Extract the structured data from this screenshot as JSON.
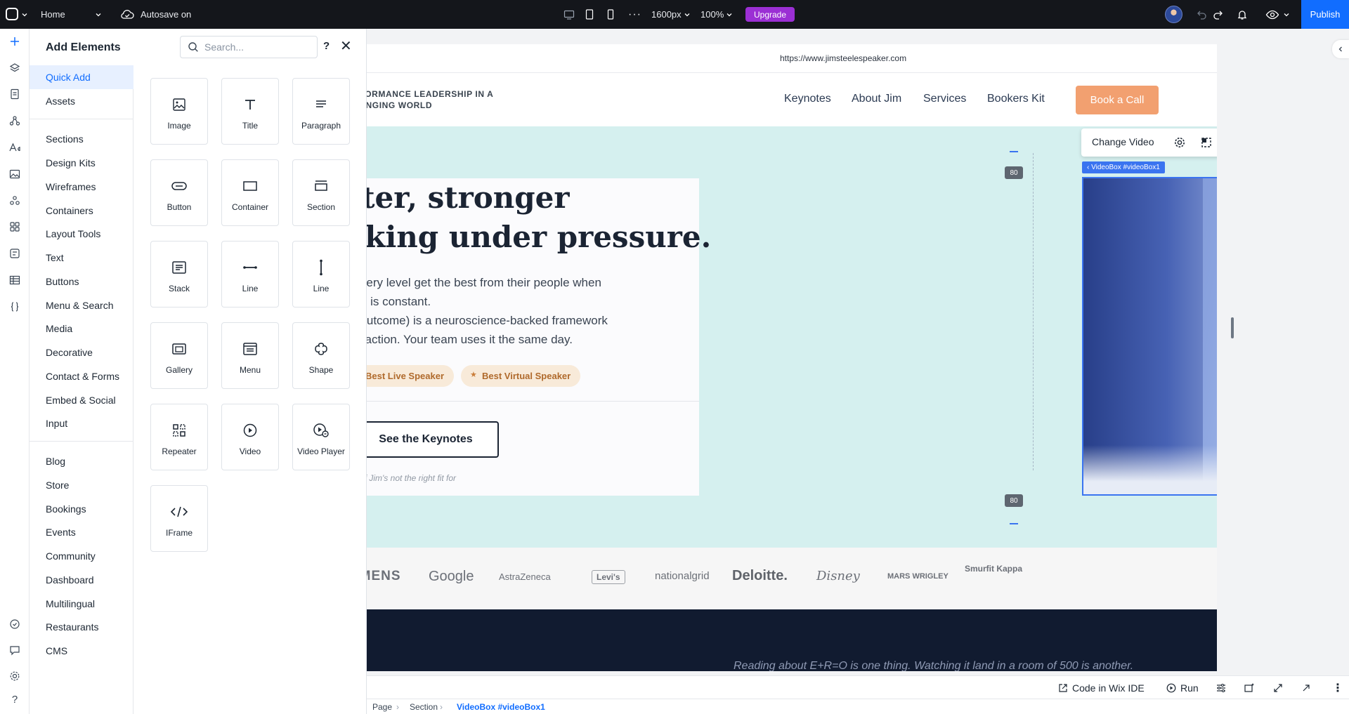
{
  "topbar": {
    "page_name": "Home",
    "autosave": "Autosave on",
    "width_label": "1600px",
    "zoom_label": "100%",
    "upgrade_label": "Upgrade",
    "publish_label": "Publish"
  },
  "panel": {
    "title": "Add Elements",
    "search_placeholder": "Search...",
    "help": "?",
    "categories_group1": [
      "Quick Add",
      "Assets"
    ],
    "categories_group2": [
      "Sections",
      "Design Kits",
      "Wireframes",
      "Containers",
      "Layout Tools",
      "Text",
      "Buttons",
      "Menu & Search",
      "Media",
      "Decorative",
      "Contact & Forms",
      "Embed & Social",
      "Input"
    ],
    "categories_group3": [
      "Blog",
      "Store",
      "Bookings",
      "Events",
      "Community",
      "Dashboard",
      "Multilingual",
      "Restaurants",
      "CMS"
    ],
    "tiles": [
      {
        "label": "Image",
        "icon": "image-icon"
      },
      {
        "label": "Title",
        "icon": "title-icon"
      },
      {
        "label": "Paragraph",
        "icon": "paragraph-icon"
      },
      {
        "label": "Button",
        "icon": "button-icon"
      },
      {
        "label": "Container",
        "icon": "container-icon"
      },
      {
        "label": "Section",
        "icon": "section-icon"
      },
      {
        "label": "Stack",
        "icon": "stack-icon"
      },
      {
        "label": "Line",
        "icon": "horizontal-line-icon"
      },
      {
        "label": "Line",
        "icon": "vertical-line-icon"
      },
      {
        "label": "Gallery",
        "icon": "gallery-icon"
      },
      {
        "label": "Menu",
        "icon": "menu-icon"
      },
      {
        "label": "Shape",
        "icon": "shape-icon"
      },
      {
        "label": "Repeater",
        "icon": "repeater-icon"
      },
      {
        "label": "Video",
        "icon": "video-icon"
      },
      {
        "label": "Video Player",
        "icon": "video-player-icon"
      },
      {
        "label": "IFrame",
        "icon": "iframe-icon"
      }
    ]
  },
  "site": {
    "url": "https://www.jimsteelespeaker.com",
    "tagline_line1": "RFORMANCE LEADERSHIP IN A",
    "tagline_line2": "HANGING WORLD",
    "nav": [
      "Keynotes",
      "About Jim",
      "Services",
      "Bookers Kit"
    ],
    "cta": "Book a Call",
    "headline_line1": "rter, stronger",
    "headline_line2": "aking under pressure.",
    "body_lines": [
      "t every level get the best from their people when",
      "nge is constant.",
      "= Outcome) is a neuroscience-backed framework",
      "r reaction. Your team uses it the same day."
    ],
    "badges": [
      "Best Live Speaker",
      "Best Virtual Speaker"
    ],
    "keynotes_button": "See the Keynotes",
    "fineprint": "ent. If Jim's not the right fit for",
    "logos": [
      "EMENS",
      "Google",
      "AstraZeneca",
      "Levi's",
      "nationalgrid",
      "Deloitte.",
      "Disney",
      "MARS WRIGLEY",
      "Smurfit Kappa"
    ],
    "dark_band_text": "Reading about E+R=O is one thing. Watching it land in a room of 500 is another."
  },
  "editor": {
    "change_video": "Change Video",
    "video_tag": "‹ VideoBox #videoBox1",
    "spacer_value": "80"
  },
  "bottom": {
    "code_ide": "Code in Wix IDE",
    "run": "Run",
    "breadcrumb": [
      "Page",
      "Section",
      "VideoBox #videoBox1"
    ]
  },
  "colors": {
    "accent": "#116dff",
    "upgrade": "#9b2fd4",
    "hero_bg": "#d5f0ef",
    "cta": "#f2a070",
    "dark_band": "#111b30"
  }
}
